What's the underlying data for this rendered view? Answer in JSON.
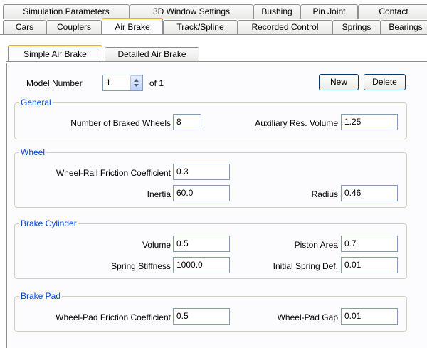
{
  "tabs_row1": [
    "Simulation Parameters",
    "3D Window Settings",
    "Bushing",
    "Pin Joint",
    "Contact"
  ],
  "tabs_row2": [
    "Cars",
    "Couplers",
    "Air Brake",
    "Track/Spline",
    "Recorded Control",
    "Springs",
    "Bearings"
  ],
  "tabs_row2_active": "Air Brake",
  "subtabs": [
    "Simple Air Brake",
    "Detailed Air Brake"
  ],
  "subtabs_active": "Simple Air Brake",
  "model": {
    "label": "Model Number",
    "value": "1",
    "of_text": "of 1",
    "new_label": "New",
    "delete_label": "Delete"
  },
  "general": {
    "title": "General",
    "braked_wheels_label": "Number of Braked Wheels",
    "braked_wheels_value": "8",
    "aux_volume_label": "Auxiliary Res. Volume",
    "aux_volume_value": "1.25"
  },
  "wheel": {
    "title": "Wheel",
    "friction_label": "Wheel-Rail Friction Coefficient",
    "friction_value": "0.3",
    "inertia_label": "Inertia",
    "inertia_value": "60.0",
    "radius_label": "Radius",
    "radius_value": "0.46"
  },
  "brake_cylinder": {
    "title": "Brake Cylinder",
    "volume_label": "Volume",
    "volume_value": "0.5",
    "piston_area_label": "Piston Area",
    "piston_area_value": "0.7",
    "spring_stiffness_label": "Spring Stiffness",
    "spring_stiffness_value": "1000.0",
    "initial_def_label": "Initial Spring Def.",
    "initial_def_value": "0.01"
  },
  "brake_pad": {
    "title": "Brake Pad",
    "pad_friction_label": "Wheel-Pad Friction Coefficient",
    "pad_friction_value": "0.5",
    "pad_gap_label": "Wheel-Pad Gap",
    "pad_gap_value": "0.01"
  },
  "colors": {
    "group_title": "#0046d5",
    "active_tab_accent": "#f5a623"
  }
}
